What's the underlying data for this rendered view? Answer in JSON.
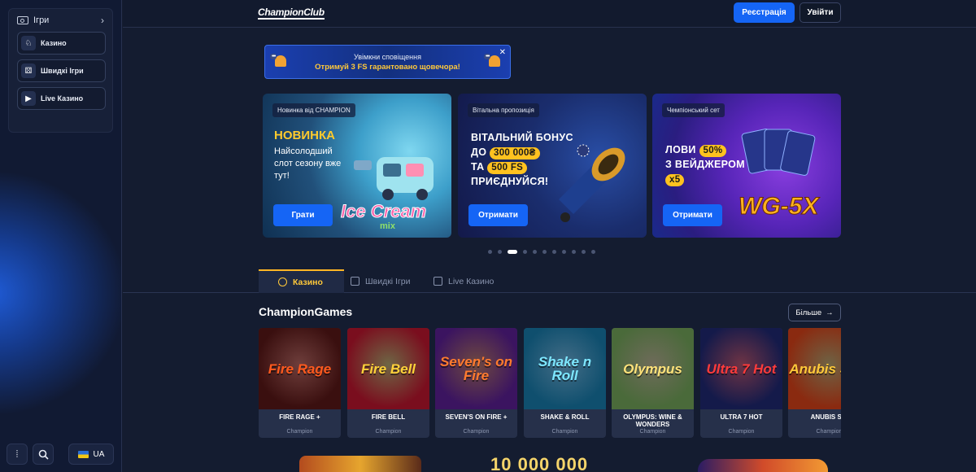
{
  "sidebar": {
    "games_label": "Ігри",
    "items": [
      {
        "label": "Казино",
        "icon": "casino-icon"
      },
      {
        "label": "Швидкі Ігри",
        "icon": "dice-icon"
      },
      {
        "label": "Live Казино",
        "icon": "live-icon"
      }
    ],
    "language": "UA"
  },
  "header": {
    "logo": "ChampionClub",
    "register_label": "Реєстрація",
    "login_label": "Увійти"
  },
  "notification": {
    "line1": "Увімкни сповіщення",
    "line2": "Отримуй 3 FS гарантовано щовечора!",
    "close": "✕"
  },
  "promos": [
    {
      "tag": "Новинка від CHAMPION",
      "title": "НОВИНКА",
      "subtitle": "Найсолодший слот сезону вже тут!",
      "art_text": "Ice Cream mix",
      "button": "Грати"
    },
    {
      "tag": "Вітальна пропозиція",
      "line1": "ВІТАЛЬНИЙ БОНУС",
      "line2_prefix": "ДО",
      "line2_pill": "300 000₴",
      "line3_prefix": "ТА",
      "line3_pill": "500 FS",
      "line4": "ПРИЄДНУЙСЯ!",
      "button": "Отримати"
    },
    {
      "tag": "Чемпіонський сет",
      "line1_prefix": "ЛОВИ",
      "line1_pill": "50%",
      "line2": "З ВЕЙДЖЕРОМ",
      "line3_pill": "x5",
      "art_text": "WG-5X",
      "button": "Отримати"
    }
  ],
  "carousel": {
    "count": 11,
    "active_index": 2
  },
  "tabs": [
    {
      "label": "Казино",
      "active": true
    },
    {
      "label": "Швидкі Ігри",
      "active": false
    },
    {
      "label": "Live Казино",
      "active": false
    }
  ],
  "section": {
    "title": "ChampionGames",
    "more_label": "Більше"
  },
  "games": [
    {
      "name": "FIRE RAGE +",
      "provider": "Champion",
      "art": "Fire Rage",
      "color": "#ff5a1e",
      "bg": "#3a0f0f"
    },
    {
      "name": "FIRE BELL",
      "provider": "Champion",
      "art": "Fire Bell",
      "color": "#ffd23a",
      "bg": "#7a0e1e"
    },
    {
      "name": "SEVEN'S ON FIRE +",
      "provider": "Champion",
      "art": "Seven's on Fire",
      "color": "#ff7b2e",
      "bg": "#3b1460"
    },
    {
      "name": "SHAKE & ROLL",
      "provider": "Champion",
      "art": "Shake n Roll",
      "color": "#7ee7ff",
      "bg": "#0f4f6e"
    },
    {
      "name": "OLYMPUS: WINE & WONDERS",
      "provider": "Champion",
      "art": "Olympus",
      "color": "#ffe27a",
      "bg": "#4a6a3a"
    },
    {
      "name": "ULTRA 7 HOT",
      "provider": "Champion",
      "art": "Ultra 7 Hot",
      "color": "#ff3b3b",
      "bg": "#141a4a"
    },
    {
      "name": "ANUBIS SPI",
      "provider": "Champion",
      "art": "Anubis Spel",
      "color": "#ffc93a",
      "bg": "#8a2a10"
    }
  ],
  "bottom_strip": {
    "big_number": "10 000 000"
  },
  "colors": {
    "accent_blue": "#1565f5",
    "accent_gold": "#ffc93a",
    "background": "#141c30"
  }
}
